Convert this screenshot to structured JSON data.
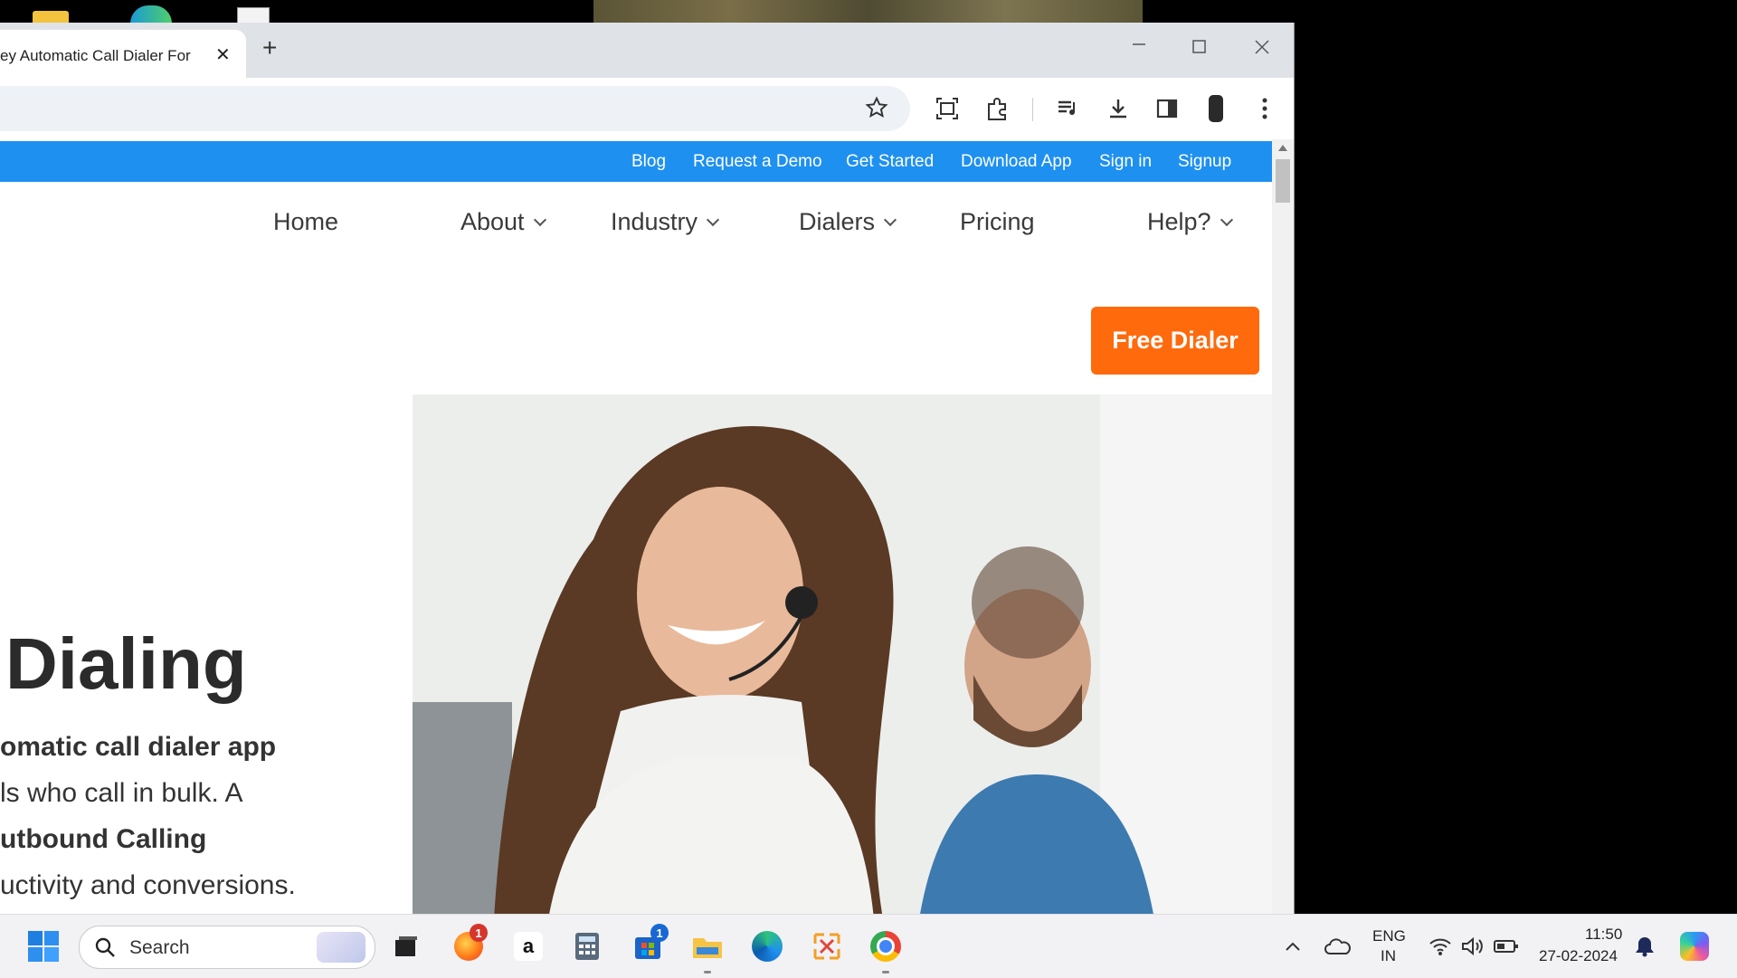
{
  "browser": {
    "tab_title": "ey Automatic Call Dialer For",
    "new_tab_symbol": "+",
    "close_tab_symbol": "✕"
  },
  "site": {
    "top_links": [
      "Blog",
      "Request a Demo",
      "Get Started",
      "Download App",
      "Sign in",
      "Signup"
    ],
    "nav": {
      "home": "Home",
      "about": "About",
      "industry": "Industry",
      "dialers": "Dialers",
      "pricing": "Pricing",
      "help": "Help?"
    },
    "cta": "Free Dialer",
    "hero": {
      "title": "Dialing",
      "line1": "omatic call dialer app",
      "line2": "ls who call in bulk. A",
      "line3": "utbound Calling",
      "line4": "uctivity and conversions."
    },
    "colors": {
      "topbar": "#1e90f0",
      "cta": "#ff6a0d"
    }
  },
  "taskbar": {
    "search_placeholder": "Search",
    "firefox_badge": "1",
    "store_badge": "1",
    "lang_line1": "ENG",
    "lang_line2": "IN",
    "time": "11:50",
    "date": "27-02-2024"
  }
}
